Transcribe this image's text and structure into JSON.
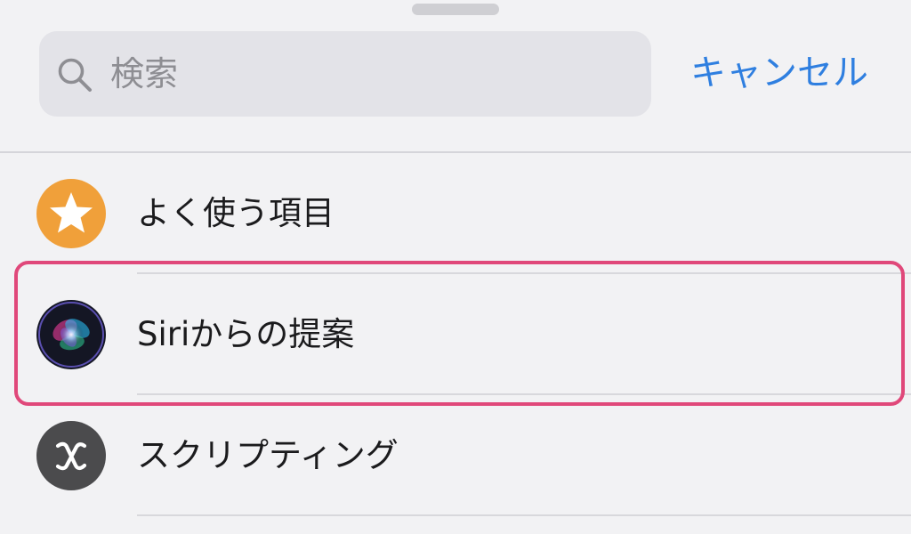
{
  "search": {
    "placeholder": "検索",
    "value": "",
    "cancel_label": "キャンセル"
  },
  "list": {
    "items": [
      {
        "label": "よく使う項目",
        "icon": "star-icon",
        "color": "#f0a03a"
      },
      {
        "label": "Siriからの提案",
        "icon": "siri-icon",
        "color": "#141624"
      },
      {
        "label": "スクリプティング",
        "icon": "variable-x-icon",
        "color": "#4b4b4d"
      }
    ],
    "highlighted_item": "Siriからの提案"
  },
  "colors": {
    "accent": "#2f7fe0",
    "highlight": "#e0487a",
    "background": "#f2f2f4"
  }
}
